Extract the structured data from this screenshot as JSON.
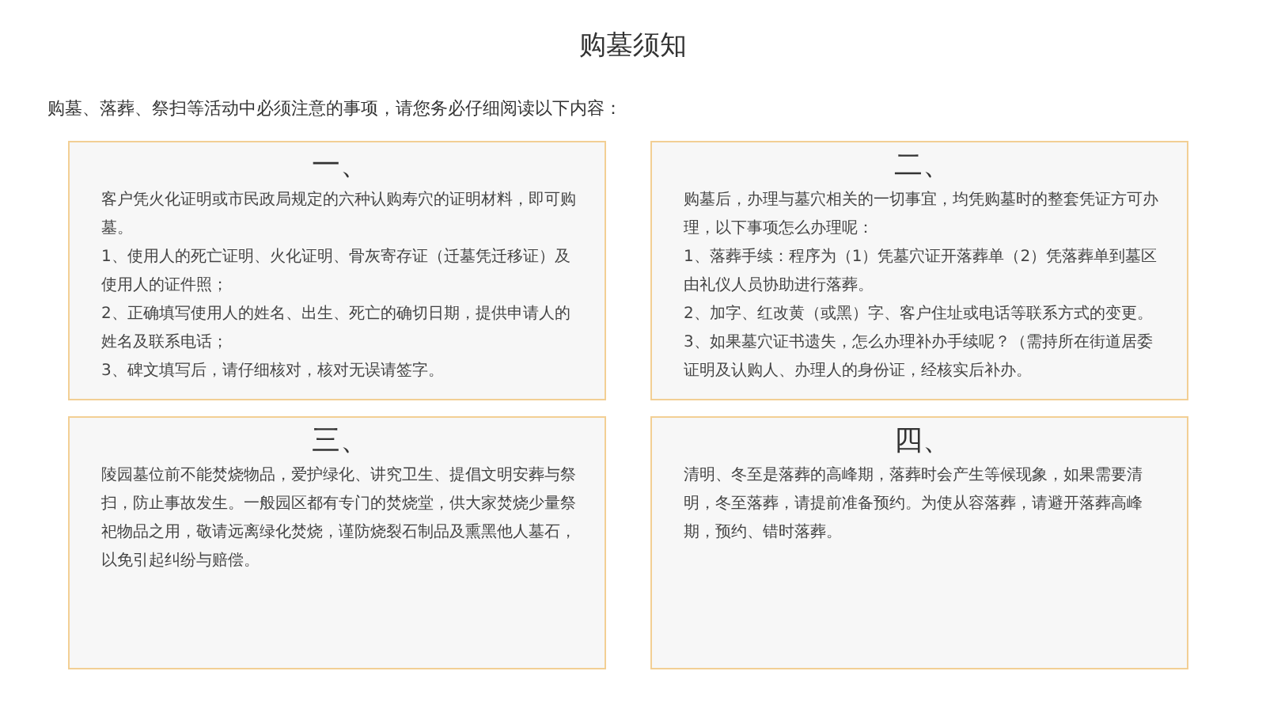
{
  "page": {
    "title": "购墓须知",
    "intro": "购墓、落葬、祭扫等活动中必须注意的事项，请您务必仔细阅读以下内容："
  },
  "cards": [
    {
      "heading": "一、",
      "paragraphs": [
        "客户凭火化证明或市民政局规定的六种认购寿穴的证明材料，即可购墓。",
        "1、使用人的死亡证明、火化证明、骨灰寄存证（迁墓凭迁移证）及使用人的证件照；",
        "2、正确填写使用人的姓名、出生、死亡的确切日期，提供申请人的姓名及联系电话；",
        "3、碑文填写后，请仔细核对，核对无误请签字。"
      ]
    },
    {
      "heading": "二、",
      "paragraphs": [
        "购墓后，办理与墓穴相关的一切事宜，均凭购墓时的整套凭证方可办理，以下事项怎么办理呢：",
        "1、落葬手续：程序为（1）凭墓穴证开落葬单（2）凭落葬单到墓区由礼仪人员协助进行落葬。",
        "2、加字、红改黄（或黑）字、客户住址或电话等联系方式的变更。",
        "3、如果墓穴证书遗失，怎么办理补办手续呢？（需持所在街道居委证明及认购人、办理人的身份证，经核实后补办。"
      ]
    },
    {
      "heading": "三、",
      "paragraphs": [
        "陵园墓位前不能焚烧物品，爱护绿化、讲究卫生、提倡文明安葬与祭扫，防止事故发生。一般园区都有专门的焚烧堂，供大家焚烧少量祭祀物品之用，敬请远离绿化焚烧，谨防烧裂石制品及熏黑他人墓石，以免引起纠纷与赔偿。"
      ]
    },
    {
      "heading": "四、",
      "paragraphs": [
        "清明、冬至是落葬的高峰期，落葬时会产生等候现象，如果需要清明，冬至落葬，请提前准备预约。为使从容落葬，请避开落葬高峰期，预约、错时落葬。"
      ]
    }
  ]
}
